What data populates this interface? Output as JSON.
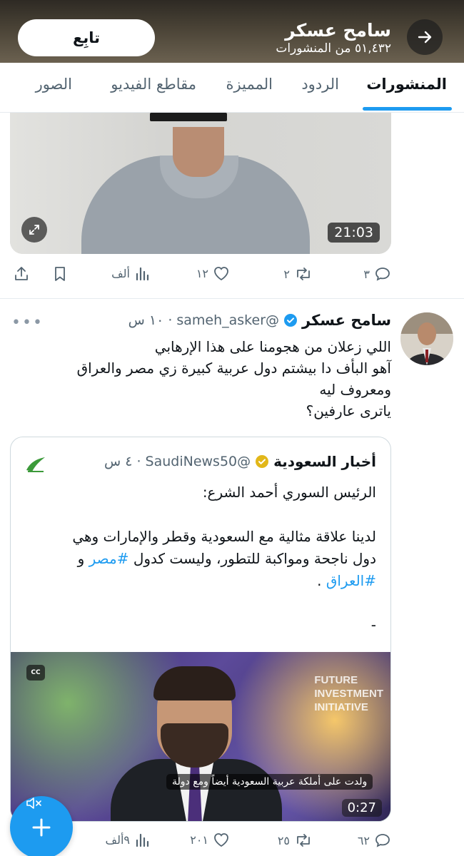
{
  "header": {
    "name": "سامح عسكر",
    "post_count": "٥١,٤٣٢ من المنشورات",
    "follow_label": "تابِع"
  },
  "tabs": [
    {
      "label": "المنشورات",
      "active": true
    },
    {
      "label": "الردود",
      "active": false
    },
    {
      "label": "المميزة",
      "active": false
    },
    {
      "label": "مقاطع الفيديو",
      "active": false
    },
    {
      "label": "الصور",
      "active": false
    }
  ],
  "tweet1": {
    "video_duration": "21:03",
    "replies": "٣",
    "reposts": "٢",
    "likes": "١٢",
    "views": "ألف"
  },
  "tweet2": {
    "name": "سامح عسكر",
    "handle": "@sameh_asker",
    "time": "١٠ س",
    "text_lines": [
      "اللي زعلان من هجومنا على هذا الإرهابي",
      "آهو البأف دا بيشتم دول عربية كبيرة زي مصر والعراق",
      "ومعروف ليه",
      "ياترى عارفين؟"
    ],
    "quote": {
      "name": "أخبار السعودية",
      "handle": "@SaudiNews50",
      "time": "٤ س",
      "line1": "الرئيس السوري أحمد الشرع:",
      "line2": "لدينا علاقة مثالية مع السعودية وقطر والإمارات وهي",
      "line3_text": "دول ناجحة ومواكبة للتطور، وليست كدول",
      "hashtag_egypt": "#مصر",
      "and": "و",
      "hashtag_iraq": "#العراق",
      "period": ".",
      "dash": "-",
      "video_watermark": "FUTURE\nINVESTMENT\nINITIATIVE",
      "video_subtitle": "ولدت على أملكة عربية السعودية أيضاً ومع دولة",
      "video_duration": "0:27",
      "cc_label": "CC"
    },
    "replies": "٦٢",
    "reposts": "٢٥",
    "likes": "٢٠١",
    "views": "٩ألف"
  },
  "colors": {
    "accent": "#1d9bf0",
    "text_secondary": "#536471",
    "divider": "#e6ebef"
  },
  "icons": [
    "back-arrow-icon",
    "expand-icon",
    "reply-icon",
    "repost-icon",
    "like-icon",
    "views-icon",
    "bookmark-icon",
    "share-icon",
    "verified-icon",
    "more-icon",
    "cc-icon",
    "mute-icon",
    "compose-icon"
  ]
}
